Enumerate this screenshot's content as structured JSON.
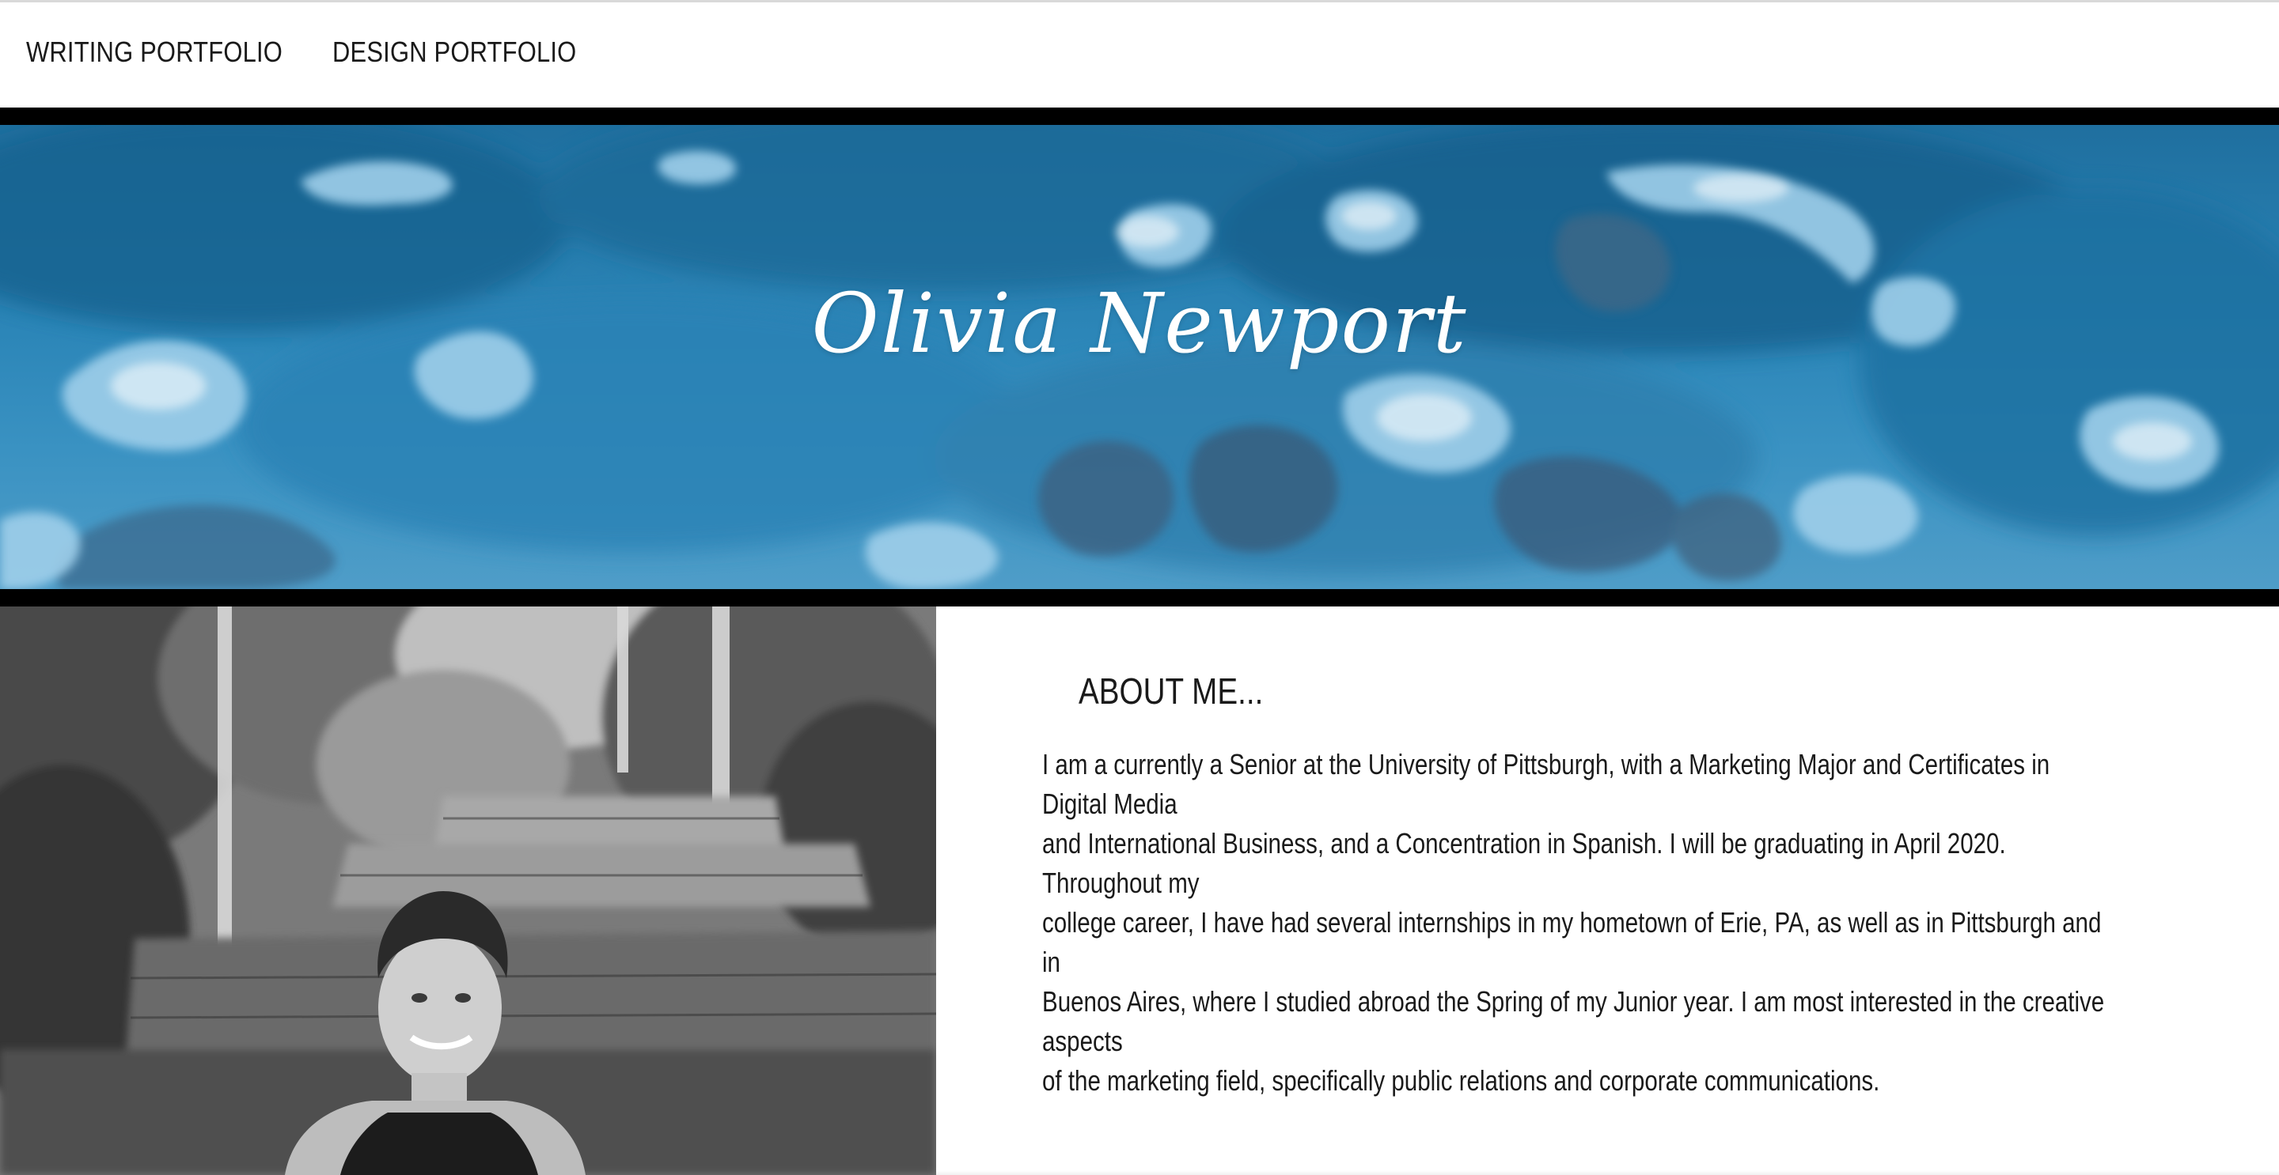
{
  "nav": {
    "items": [
      {
        "label": "WRITING PORTFOLIO"
      },
      {
        "label": "DESIGN PORTFOLIO"
      }
    ]
  },
  "hero": {
    "title": "Olivia Newport"
  },
  "about": {
    "heading": "ABOUT ME...",
    "lines": [
      "I am a currently a Senior at the University of Pittsburgh, with a Marketing Major and Certificates in Digital Media",
      "and International Business, and a Concentration in Spanish. I will be graduating in April 2020. Throughout my",
      "college career, I have had several internships in my hometown of Erie, PA, as well as in Pittsburgh and in",
      "Buenos Aires, where I studied abroad the Spring of my Junior year. I am most interested in the creative aspects",
      "of the marketing field, specifically public relations and corporate communications."
    ]
  },
  "colors": {
    "bar": "#000000",
    "hero_blue": "#2c86b8",
    "text": "#1a1a1a"
  }
}
